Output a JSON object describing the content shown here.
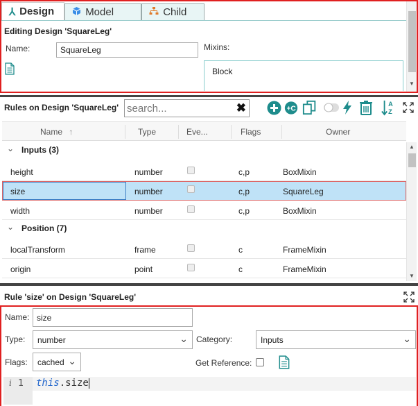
{
  "tabs": [
    {
      "label": "Design",
      "icon": "design-icon",
      "active": true
    },
    {
      "label": "Model",
      "icon": "cube-icon",
      "active": false
    },
    {
      "label": "Child",
      "icon": "hierarchy-icon",
      "active": false
    }
  ],
  "design": {
    "title": "Editing Design 'SquareLeg'",
    "name_label": "Name:",
    "name_value": "SquareLeg",
    "mixins_label": "Mixins:",
    "mixins_value": "Block"
  },
  "rules": {
    "title": "Rules on Design 'SquareLeg'",
    "search_placeholder": "search...",
    "columns": [
      "Name",
      "Type",
      "Eve...",
      "Flags",
      "Owner"
    ],
    "sort_indicator": "↑",
    "groups": [
      {
        "label": "Inputs (3)",
        "rows": [
          {
            "name": "height",
            "type": "number",
            "event": false,
            "flags": "c,p",
            "owner": "BoxMixin",
            "selected": false
          },
          {
            "name": "size",
            "type": "number",
            "event": false,
            "flags": "c,p",
            "owner": "SquareLeg",
            "selected": true
          },
          {
            "name": "width",
            "type": "number",
            "event": false,
            "flags": "c,p",
            "owner": "BoxMixin",
            "selected": false
          }
        ]
      },
      {
        "label": "Position (7)",
        "rows": [
          {
            "name": "localTransform",
            "type": "frame",
            "event": false,
            "flags": "c",
            "owner": "FrameMixin",
            "selected": false
          },
          {
            "name": "origin",
            "type": "point",
            "event": false,
            "flags": "c",
            "owner": "FrameMixin",
            "selected": false
          }
        ]
      }
    ]
  },
  "rule": {
    "title": "Rule 'size' on Design 'SquareLeg'",
    "name_label": "Name:",
    "name_value": "size",
    "type_label": "Type:",
    "type_value": "number",
    "category_label": "Category:",
    "category_value": "Inputs",
    "flags_label": "Flags:",
    "flags_value": "cached",
    "getref_label": "Get Reference:",
    "code_info": "i",
    "code_line": "1",
    "code_keyword": "this",
    "code_rest": ".size"
  },
  "colors": {
    "accent": "#1e8c8c",
    "highlight": "#e02020",
    "selection": "#bfe2f7"
  }
}
